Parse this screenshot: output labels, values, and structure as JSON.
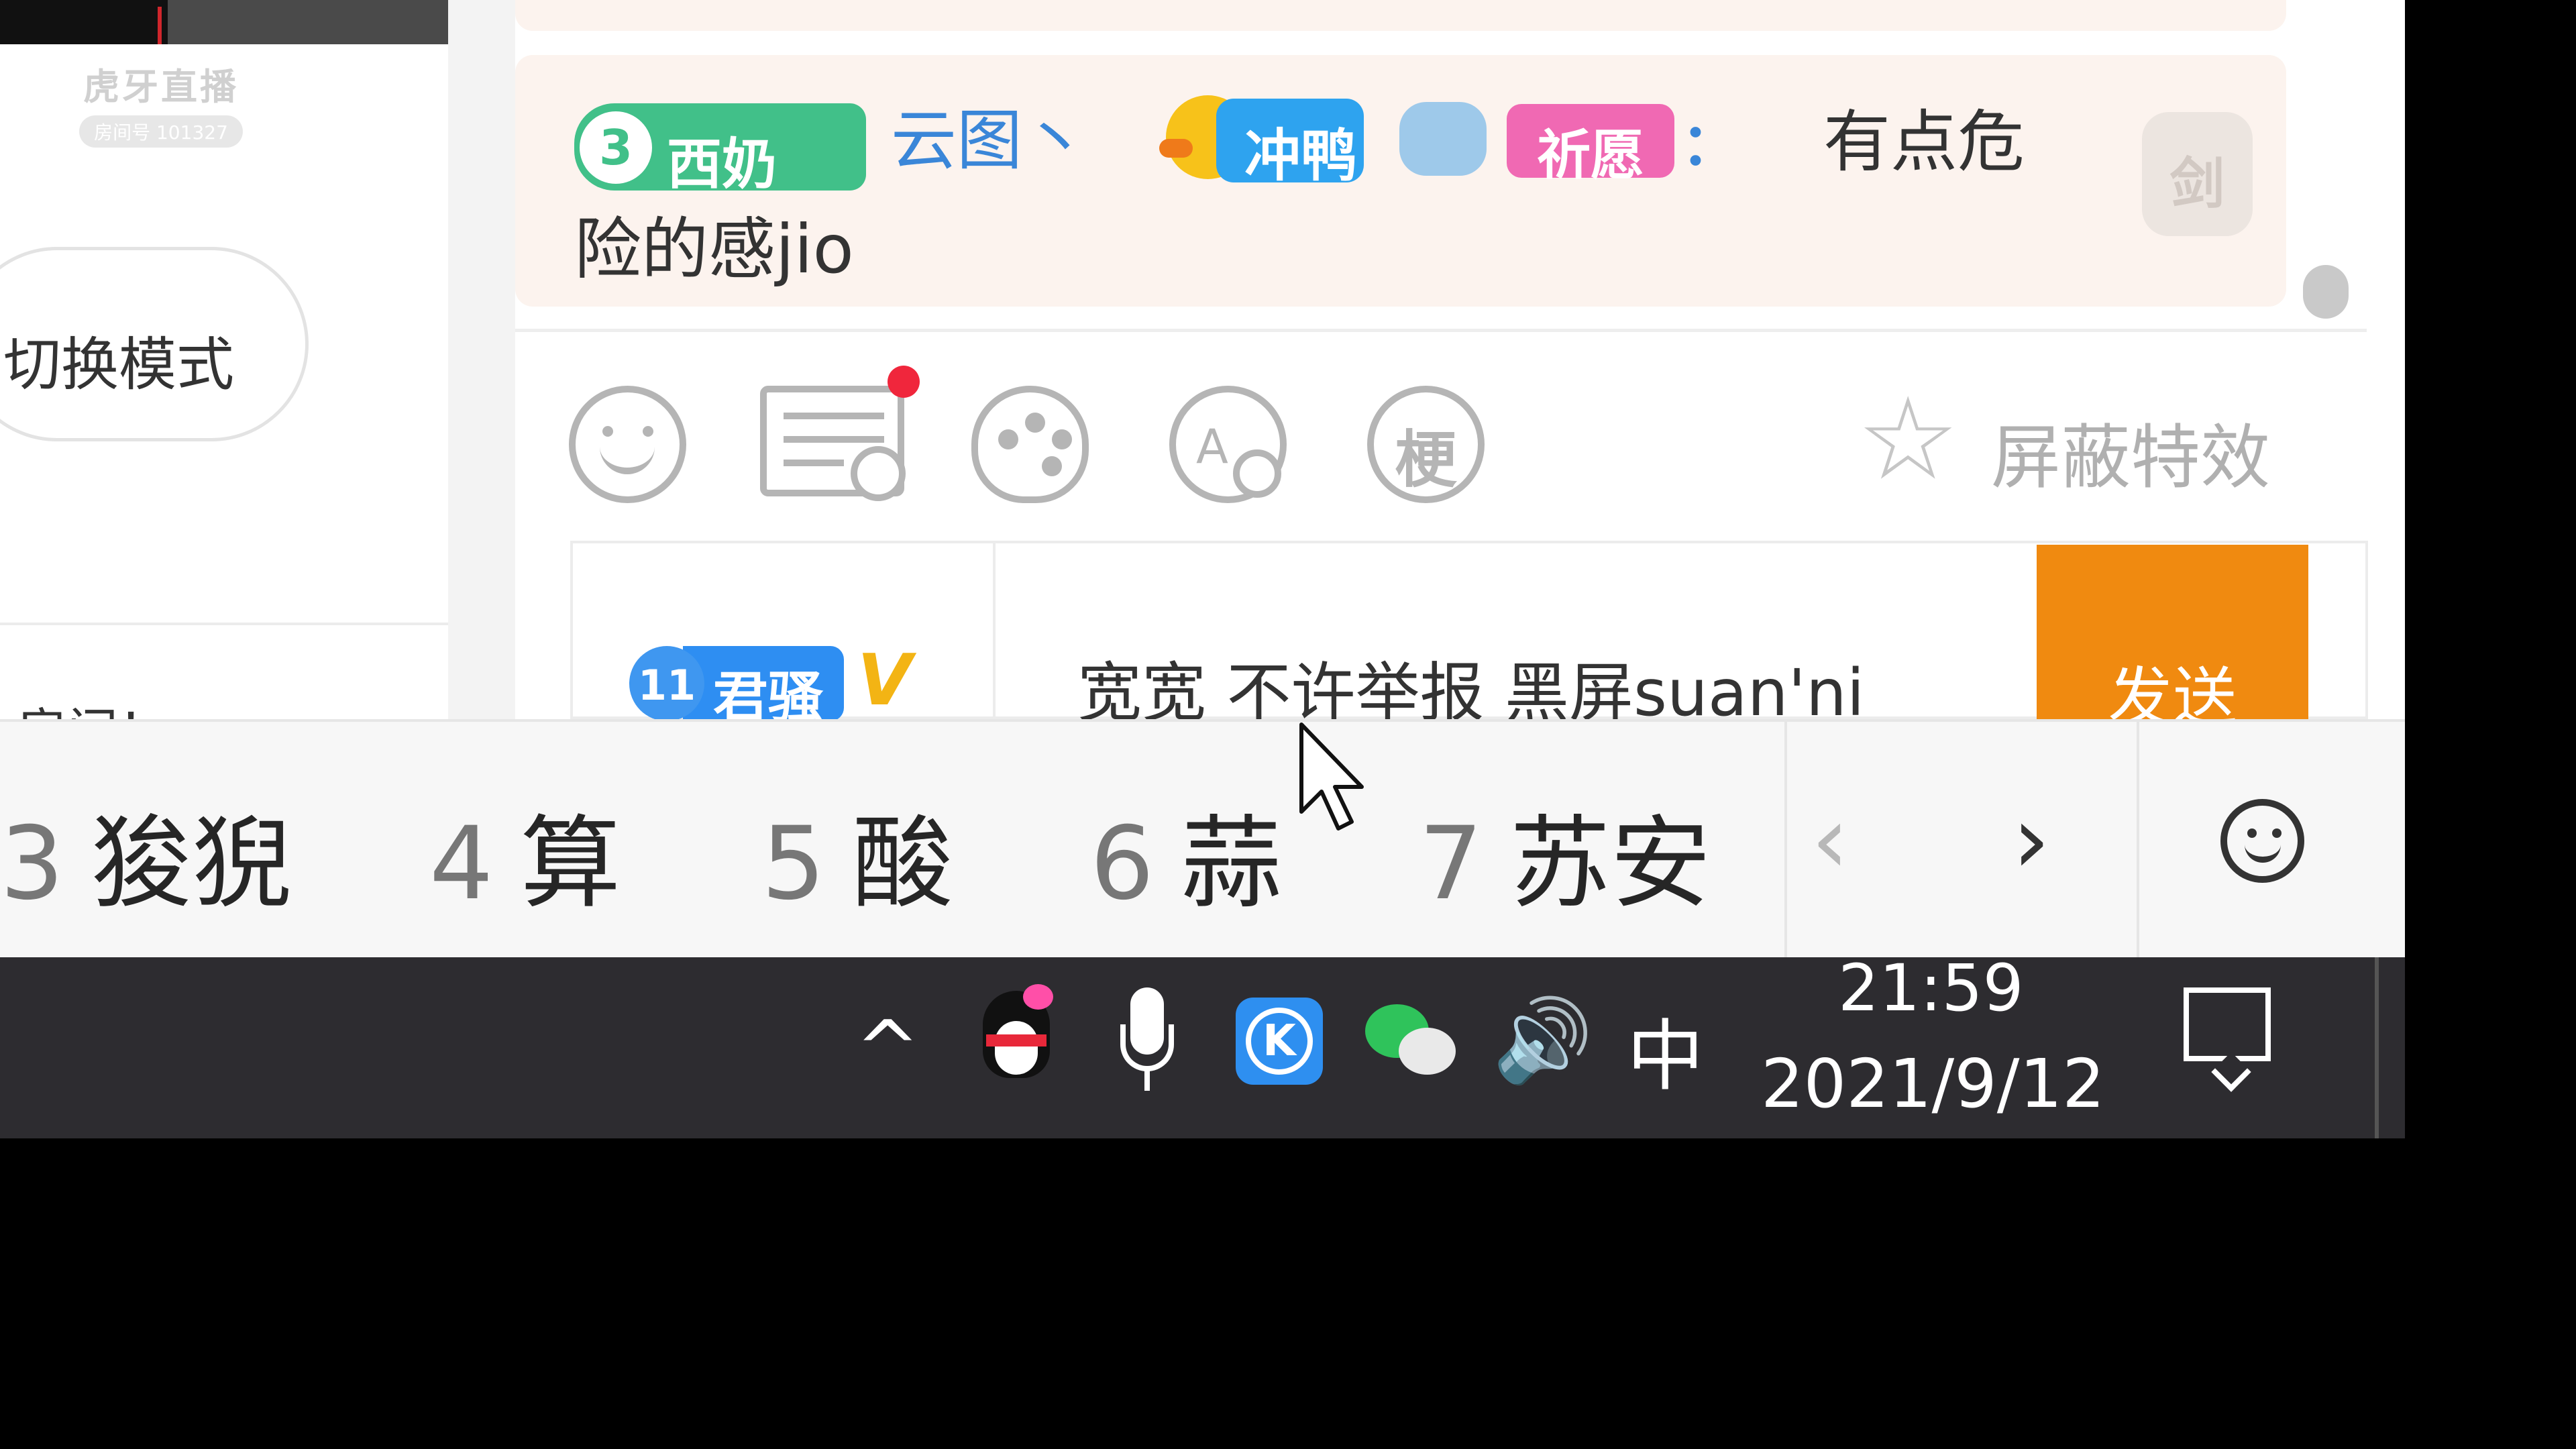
{
  "stream": {
    "watermark_title": "虎牙直播",
    "watermark_room": "房间号 101327",
    "mode_button": "切换模式",
    "left_partial_text": "·房间！"
  },
  "chat": {
    "message": {
      "level_badge": "3",
      "badge_name": "西奶",
      "username": "云图丶",
      "gift1_label": "冲鸭",
      "gift2_label": "祈愿",
      "colon": "：",
      "text_line1": "有点危",
      "text_line2": "险的感jio",
      "right_icon": "剑"
    },
    "toolbar": {
      "tools": [
        "emoji-icon",
        "notice-icon",
        "palette-icon",
        "text-ban-icon",
        "meme-icon"
      ],
      "meme_label": "梗",
      "text_tool_label": "A",
      "block_effects_label": "屏蔽特效",
      "block_effects_icon": "☆"
    },
    "input": {
      "fan_level": "11",
      "fan_name": "君骚",
      "vip_mark": "V",
      "value": "宽宽 不许举报 黑屏suan'ni",
      "send_label": "发送"
    }
  },
  "ime": {
    "candidates": [
      {
        "num": "3",
        "text": "狻猊"
      },
      {
        "num": "4",
        "text": "算"
      },
      {
        "num": "5",
        "text": "酸"
      },
      {
        "num": "6",
        "text": "蒜"
      },
      {
        "num": "7",
        "text": "苏安"
      }
    ],
    "prev_label": "‹",
    "next_label": "›"
  },
  "taskbar": {
    "tray_up_label": "^",
    "volume_label": "🔊",
    "ime_mode": "中",
    "time": "21:59",
    "date": "2021/9/12"
  }
}
